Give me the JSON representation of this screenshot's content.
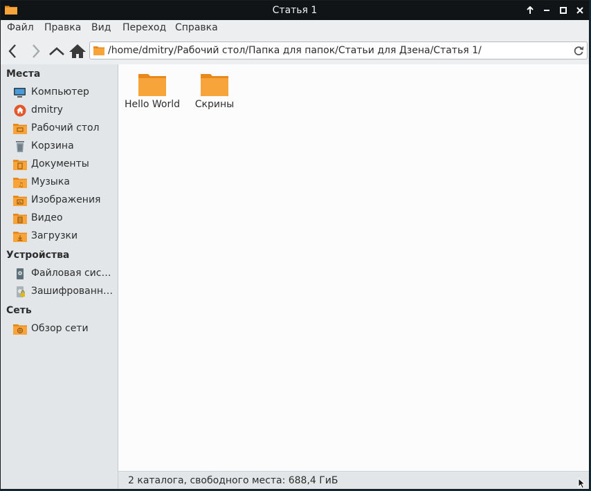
{
  "window": {
    "title": "Статья 1"
  },
  "menu": [
    "Файл",
    "Правка",
    "Вид",
    "Переход",
    "Справка"
  ],
  "address": {
    "path": "/home/dmitry/Рабочий стол/Папка для папок/Статьи для Дзена/Статья 1/"
  },
  "sidebar": {
    "places_title": "Места",
    "places": [
      {
        "label": "Компьютер",
        "icon": "computer-icon"
      },
      {
        "label": "dmitry",
        "icon": "home-icon"
      },
      {
        "label": "Рабочий стол",
        "icon": "desktop-folder-icon"
      },
      {
        "label": "Корзина",
        "icon": "trash-icon"
      },
      {
        "label": "Документы",
        "icon": "documents-folder-icon"
      },
      {
        "label": "Музыка",
        "icon": "music-folder-icon"
      },
      {
        "label": "Изображения",
        "icon": "pictures-folder-icon"
      },
      {
        "label": "Видео",
        "icon": "video-folder-icon"
      },
      {
        "label": "Загрузки",
        "icon": "downloads-folder-icon"
      }
    ],
    "devices_title": "Устройства",
    "devices": [
      {
        "label": "Файловая система",
        "icon": "drive-icon"
      },
      {
        "label": "Зашифрованный том",
        "icon": "encrypted-drive-icon"
      }
    ],
    "network_title": "Сеть",
    "network": [
      {
        "label": "Обзор сети",
        "icon": "network-folder-icon"
      }
    ]
  },
  "files": [
    {
      "name": "Hello World",
      "icon": "folder-icon"
    },
    {
      "name": "Скрины",
      "icon": "folder-icon"
    }
  ],
  "status": {
    "text": "2 каталога, свободного места: 688,4 ГиБ"
  },
  "colors": {
    "folder": "#f7a43a",
    "folder_dark": "#e88a1b",
    "titlebar": "#111417"
  }
}
